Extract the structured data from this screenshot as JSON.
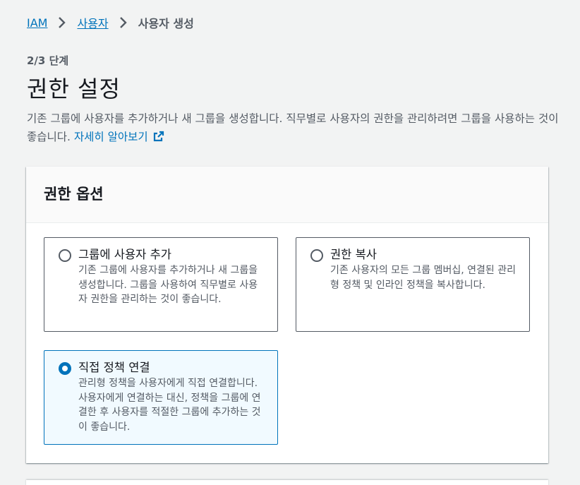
{
  "breadcrumb": {
    "items": [
      "IAM",
      "사용자"
    ],
    "current": "사용자 생성"
  },
  "step": "2/3 단계",
  "page_title": "권한 설정",
  "description": {
    "text": "기존 그룹에 사용자를 추가하거나 새 그룹을 생성합니다. 직무별로 사용자의 권한을 관리하려면 그룹을 사용하는 것이 좋습니다. ",
    "link": "자세히 알아보기",
    "link_icon": "external-link-icon"
  },
  "permission_options": {
    "title": "권한 옵션",
    "options": [
      {
        "label": "그룹에 사용자 추가",
        "description": "기존 그룹에 사용자를 추가하거나 새 그룹을 생성합니다. 그룹을 사용하여 직무별로 사용자 권한을 관리하는 것이 좋습니다.",
        "selected": false
      },
      {
        "label": "권한 복사",
        "description": "기존 사용자의 모든 그룹 멤버십, 연결된 관리형 정책 및 인라인 정책을 복사합니다.",
        "selected": false
      },
      {
        "label": "직접 정책 연결",
        "description": "관리형 정책을 사용자에게 직접 연결합니다. 사용자에게 연결하는 대신, 정책을 그룹에 연결한 후 사용자를 적절한 그룹에 추가하는 것이 좋습니다.",
        "selected": true
      }
    ]
  },
  "colors": {
    "link": "#0073bb",
    "selected_border": "#0073bb",
    "selected_bg": "#f1faff",
    "page_bg": "#f2f3f3"
  }
}
